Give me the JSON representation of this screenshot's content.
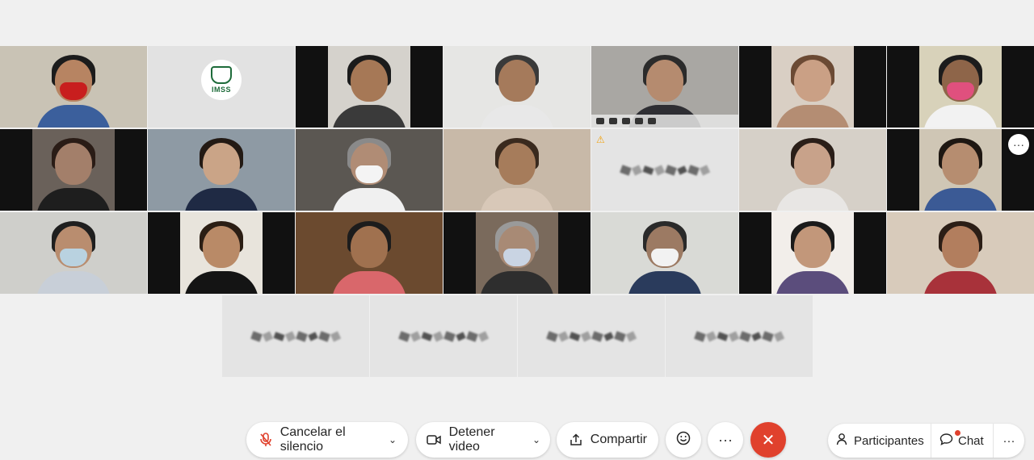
{
  "grid_tiles": [
    {
      "type": "video",
      "bg": "#c9c3b5",
      "skin": "#b78462",
      "hair": "#1c1c1c",
      "shirt": "#3b5f9c",
      "mask": "#c81e1e",
      "sides": false
    },
    {
      "type": "logo",
      "logo_text": "IMSS"
    },
    {
      "type": "video",
      "bg": "#d5d2cc",
      "skin": "#a67856",
      "hair": "#1b1b1b",
      "shirt": "#3a3a3a",
      "mask": "",
      "sides": true
    },
    {
      "type": "video",
      "bg": "#e6e6e4",
      "skin": "#a57a5b",
      "hair": "#3a3a3a",
      "shirt": "#e8e8e8",
      "mask": "",
      "sides": false
    },
    {
      "type": "active",
      "bg": "#a9a7a3",
      "skin": "#b58b6f",
      "hair": "#2b2b2b",
      "shirt": "#2e2e33",
      "mask": "",
      "sides": false
    },
    {
      "type": "video",
      "bg": "#d9cfc4",
      "skin": "#caa085",
      "hair": "#6b4a34",
      "shirt": "#b48d73",
      "mask": "",
      "sides": true
    },
    {
      "type": "video",
      "bg": "#d8d2ba",
      "skin": "#8e6549",
      "hair": "#1c1c1c",
      "shirt": "#f2f2f2",
      "mask": "#e0507e",
      "sides": true
    },
    {
      "type": "video",
      "bg": "#6a615a",
      "skin": "#a37f6a",
      "hair": "#2a1c16",
      "shirt": "#1e1e1e",
      "mask": "",
      "sides": true
    },
    {
      "type": "video",
      "bg": "#8e9aa4",
      "skin": "#caa487",
      "hair": "#231a14",
      "shirt": "#1f2a44",
      "mask": "",
      "sides": false
    },
    {
      "type": "video",
      "bg": "#5b5752",
      "skin": "#b08c75",
      "hair": "#8a8a8a",
      "shirt": "#f0f0f0",
      "mask": "#f4f4f4",
      "sides": false
    },
    {
      "type": "video",
      "bg": "#c8b9a8",
      "skin": "#a67c5b",
      "hair": "#3a2a1e",
      "shirt": "#d8c8b8",
      "mask": "",
      "sides": false
    },
    {
      "type": "placeholder",
      "warning": "⚠"
    },
    {
      "type": "video",
      "bg": "#d6d0c8",
      "skin": "#c8a28a",
      "hair": "#2a1e18",
      "shirt": "#e8e6e4",
      "mask": "",
      "sides": false
    },
    {
      "type": "video_more",
      "bg": "#cfc6b5",
      "skin": "#b68d70",
      "hair": "#1e1712",
      "shirt": "#3b5a95",
      "mask": "",
      "sides": true
    },
    {
      "type": "video",
      "bg": "#cfcfcb",
      "skin": "#b98d6f",
      "hair": "#1f1f1f",
      "shirt": "#c8cfd8",
      "mask": "#b9d2e0",
      "sides": false
    },
    {
      "type": "video",
      "bg": "#e8e4dc",
      "skin": "#b98a67",
      "hair": "#2b1e14",
      "shirt": "#141414",
      "mask": "",
      "sides": true
    },
    {
      "type": "video",
      "bg": "#6b4a2f",
      "skin": "#a0714f",
      "hair": "#1c1c1c",
      "shirt": "#d9676b",
      "mask": "",
      "sides": false
    },
    {
      "type": "video",
      "bg": "#7a6a5c",
      "skin": "#a88a75",
      "hair": "#9a9a9a",
      "shirt": "#2e2e2e",
      "mask": "#c9d4e3",
      "sides": true
    },
    {
      "type": "video",
      "bg": "#d9dad6",
      "skin": "#9c7a63",
      "hair": "#2a2a2a",
      "shirt": "#2a3b5c",
      "mask": "#f2f2f2",
      "sides": false
    },
    {
      "type": "video",
      "bg": "#f2eeea",
      "skin": "#c2977a",
      "hair": "#1a1a1a",
      "shirt": "#5b4d7c",
      "mask": "",
      "sides": true
    },
    {
      "type": "video",
      "bg": "#d8cbbb",
      "skin": "#b27e5e",
      "hair": "#2b1e16",
      "shirt": "#a8323a",
      "mask": "",
      "sides": false
    }
  ],
  "bottom_tiles": [
    {
      "type": "placeholder"
    },
    {
      "type": "placeholder"
    },
    {
      "type": "placeholder"
    },
    {
      "type": "placeholder"
    }
  ],
  "controls": {
    "mute_label": "Cancelar el silencio",
    "video_label": "Detener video",
    "share_label": "Compartir",
    "reactions_icon": "smiley-icon",
    "more_label": "···",
    "end_icon": "close-icon",
    "participants_label": "Participantes",
    "chat_label": "Chat",
    "overflow_label": "···"
  },
  "tile_more_label": "···",
  "colors": {
    "accent": "#1ba1e2",
    "end_call": "#e0412d",
    "warning": "#f2a20c"
  }
}
